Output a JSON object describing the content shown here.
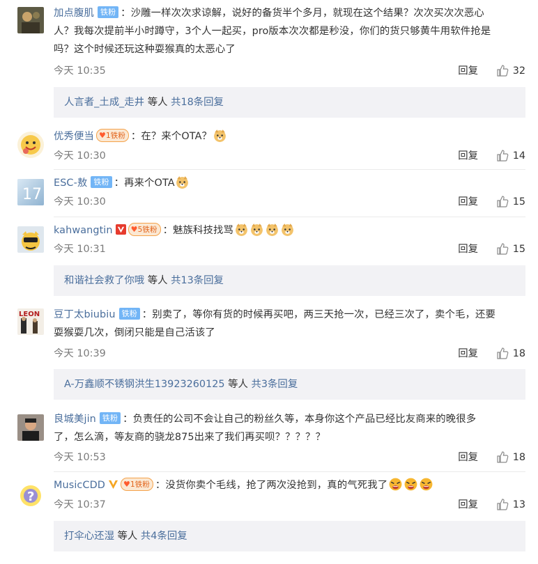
{
  "comments": [
    {
      "username": "加点腹肌",
      "badges": [
        "fan"
      ],
      "fan_label": "铁粉",
      "lines": [
        "：沙雕一样次次求谅解，说好的备货半个多月，就现在这个结果？次次买次次恶心",
        "人？我每次提前半小时蹲守，3个人一起买，pro版本次次都是秒没，你们的货只够黄牛用软件抢是",
        "吗？这个时候还玩这种耍猴真的太恶心了"
      ],
      "time": "今天 10:35",
      "reply_label": "回复",
      "likes": "32",
      "sub_replies": {
        "name": "人言者_土成_走井",
        "tail": " 等人 ",
        "count": "共18条回复"
      }
    },
    {
      "username": "优秀便当",
      "badges": [
        "vip"
      ],
      "vip_label": "铁粉",
      "vip_level": "1",
      "lines": [
        "：在？来个OTA？"
      ],
      "emoji_count": 1,
      "time": "今天 10:30",
      "reply_label": "回复",
      "likes": "14"
    },
    {
      "username": "ESC-敖",
      "badges": [
        "fan"
      ],
      "fan_label": "铁粉",
      "lines": [
        "：再来个OTA"
      ],
      "emoji_count": 1,
      "time": "今天 10:30",
      "reply_label": "回复",
      "likes": "15"
    },
    {
      "username": "kahwangtin",
      "badges": [
        "v",
        "vip"
      ],
      "vip_label": "铁粉",
      "vip_level": "5",
      "lines": [
        "：魅族科技找骂"
      ],
      "emoji_count": 4,
      "time": "今天 10:31",
      "reply_label": "回复",
      "likes": "15",
      "sub_replies": {
        "name": "和谐社会救了你哦",
        "tail": " 等人 ",
        "count": "共13条回复"
      }
    },
    {
      "username": "豆丁太biubiu",
      "badges": [
        "fan"
      ],
      "fan_label": "铁粉",
      "lines": [
        "：别卖了，等你有货的时候再买吧，两三天抢一次，已经三次了，卖个毛，还要",
        "耍猴耍几次，倒闭只能是自己活该了"
      ],
      "time": "今天 10:39",
      "reply_label": "回复",
      "likes": "18",
      "sub_replies": {
        "name": "A-万鑫顺不锈钢洪生13923260125",
        "tail": " 等人 ",
        "count": "共3条回复"
      }
    },
    {
      "username": "良城美jin",
      "badges": [
        "fan"
      ],
      "fan_label": "铁粉",
      "lines": [
        "：负责任的公司不会让自己的粉丝久等，本身你这个产品已经比友商来的晚很多",
        "了，怎么滴，等友商的骁龙875出来了我们再买呗？？？？？"
      ],
      "time": "今天 10:53",
      "reply_label": "回复",
      "likes": "18"
    },
    {
      "username": "MusicCDD",
      "badges": [
        "v-gold",
        "vip"
      ],
      "vip_label": "铁粉",
      "vip_level": "1",
      "lines": [
        "：没货你卖个毛线，抢了两次没抢到，真的气死我了"
      ],
      "emoji_count": 3,
      "emoji_kind": "angry",
      "time": "今天 10:37",
      "reply_label": "回复",
      "likes": "13",
      "sub_replies": {
        "name": "打伞心还湿",
        "tail": " 等人 ",
        "count": "共4条回复"
      }
    }
  ],
  "colors": {
    "link": "#4a6e9c",
    "fan_badge": "#72b5f6",
    "meta": "#7b7b7b",
    "panel": "#f2f2f5"
  }
}
